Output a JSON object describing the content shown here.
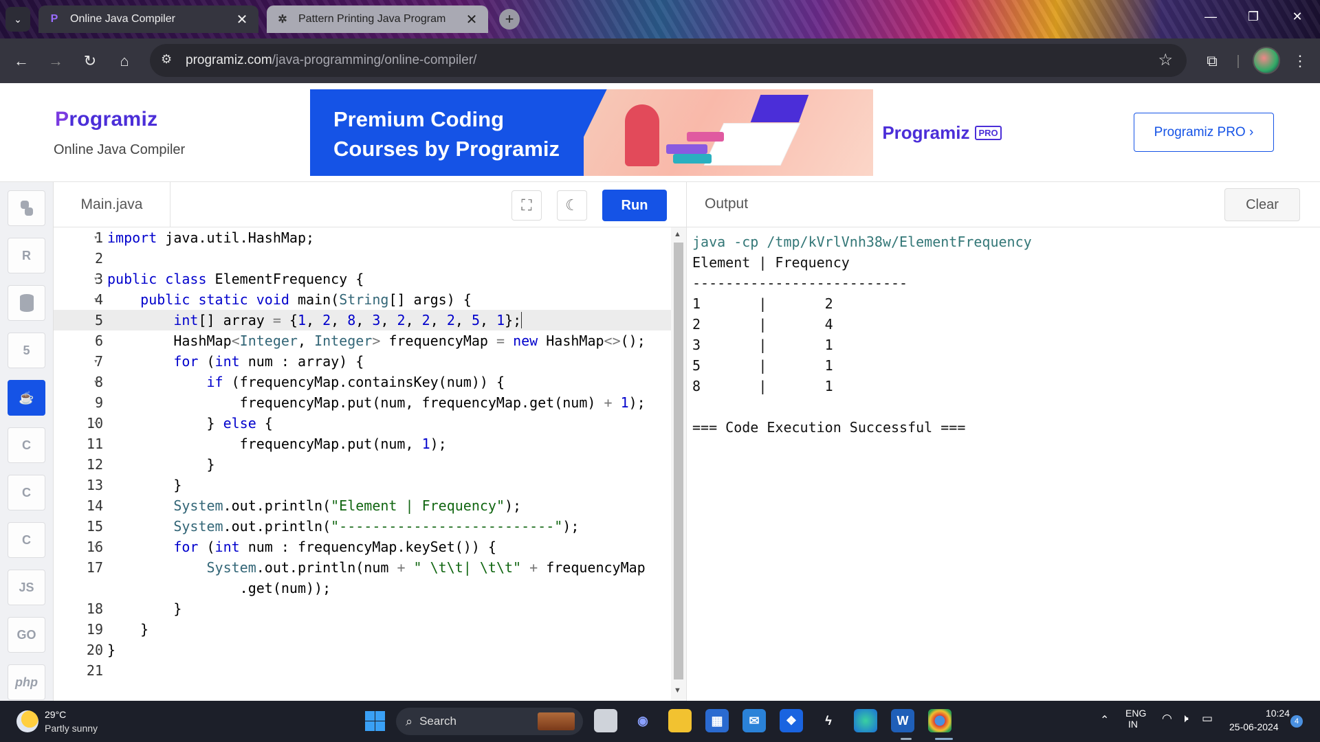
{
  "browser": {
    "tabs": [
      {
        "title": "Online Java Compiler",
        "favicon": "programiz-icon"
      },
      {
        "title": "Pattern Printing Java Program",
        "favicon": "chatgpt-icon"
      }
    ],
    "url_domain": "programiz.com",
    "url_path": "/java-programming/online-compiler/"
  },
  "header": {
    "logo": "rogramiz",
    "logo_p": "P",
    "subtitle": "Online Java Compiler",
    "banner_line1": "Premium Coding",
    "banner_line2": "Courses by Programiz",
    "banner_logo": "rogramiz",
    "banner_logo_p": "P",
    "banner_pro": "PRO",
    "pro_button": "Programiz PRO ›"
  },
  "languages": [
    {
      "name": "python-icon",
      "label": ""
    },
    {
      "name": "r-icon",
      "label": "R"
    },
    {
      "name": "sql-icon",
      "label": ""
    },
    {
      "name": "html-icon",
      "label": "5"
    },
    {
      "name": "java-icon",
      "label": "☕"
    },
    {
      "name": "c-icon",
      "label": "C"
    },
    {
      "name": "cpp-icon",
      "label": "C"
    },
    {
      "name": "csharp-icon",
      "label": "C"
    },
    {
      "name": "js-icon",
      "label": "JS"
    },
    {
      "name": "go-icon",
      "label": "GO"
    },
    {
      "name": "php-icon",
      "label": "php"
    }
  ],
  "editor": {
    "file_name": "Main.java",
    "run_label": "Run",
    "lines": [
      {
        "n": "1",
        "fold": true
      },
      {
        "n": "2",
        "fold": false
      },
      {
        "n": "3",
        "fold": true
      },
      {
        "n": "4",
        "fold": true
      },
      {
        "n": "5",
        "fold": false
      },
      {
        "n": "6",
        "fold": false
      },
      {
        "n": "7",
        "fold": true
      },
      {
        "n": "8",
        "fold": true
      },
      {
        "n": "9",
        "fold": false
      },
      {
        "n": "10",
        "fold": true
      },
      {
        "n": "11",
        "fold": false
      },
      {
        "n": "12",
        "fold": false
      },
      {
        "n": "13",
        "fold": false
      },
      {
        "n": "14",
        "fold": false
      },
      {
        "n": "15",
        "fold": false
      },
      {
        "n": "16",
        "fold": true
      },
      {
        "n": "17",
        "fold": false
      },
      {
        "n": "",
        "fold": false
      },
      {
        "n": "18",
        "fold": false
      },
      {
        "n": "19",
        "fold": false
      },
      {
        "n": "20",
        "fold": false
      },
      {
        "n": "21",
        "fold": false
      }
    ]
  },
  "output": {
    "title": "Output",
    "clear_label": "Clear",
    "command": "java -cp /tmp/kVrlVnh38w/ElementFrequency",
    "lines": [
      "Element | Frequency",
      "--------------------------",
      "1       |       2",
      "2       |       4",
      "3       |       1",
      "5       |       1",
      "8       |       1",
      "",
      "=== Code Execution Successful ==="
    ]
  },
  "taskbar": {
    "temperature": "29°C",
    "weather": "Partly sunny",
    "search_label": "Search",
    "lang_top": "ENG",
    "lang_bottom": "IN",
    "time": "10:24",
    "date": "25-06-2024",
    "notification_count": "4"
  },
  "colors": {
    "accent": "#1553e6",
    "keyword": "#0000cc",
    "string": "#116611",
    "type": "#336677"
  }
}
